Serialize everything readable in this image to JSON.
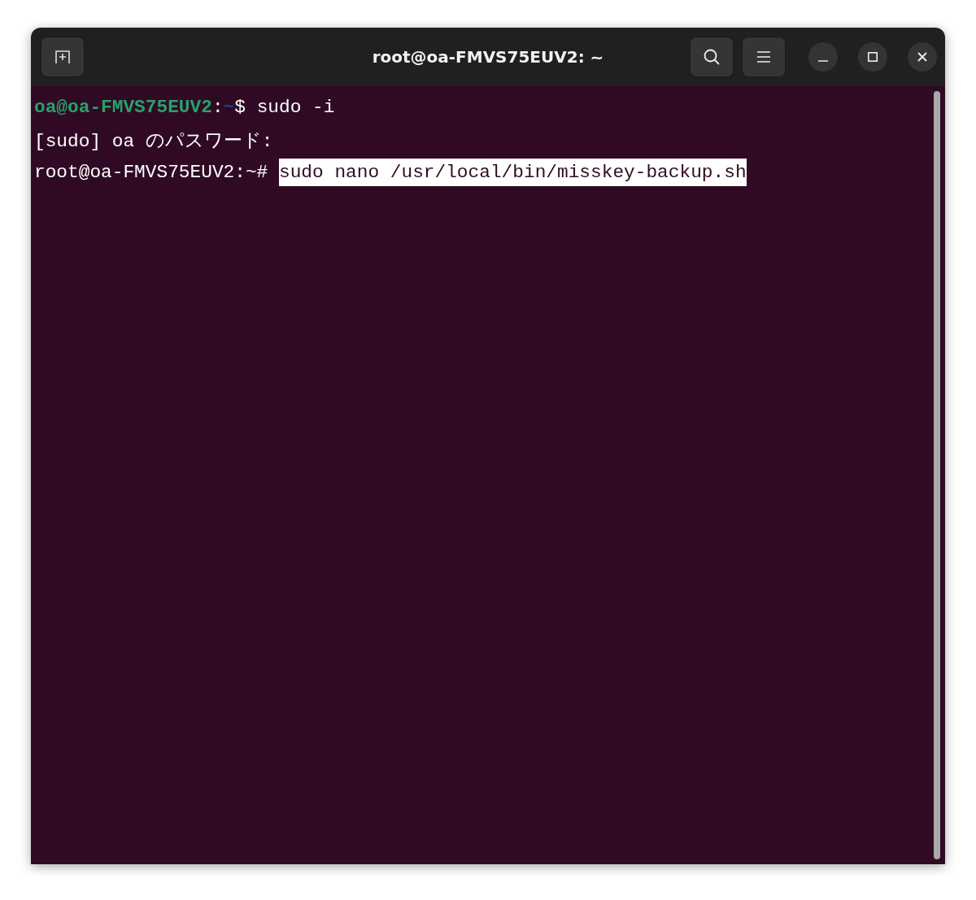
{
  "window": {
    "title": "root@oa-FMVS75EUV2: ~"
  },
  "terminal": {
    "lines": [
      {
        "prompt": [
          {
            "text": "oa@oa-FMVS75EUV2",
            "kind": "user"
          },
          {
            "text": ":",
            "kind": "plain"
          },
          {
            "text": "~",
            "kind": "path"
          },
          {
            "text": "$",
            "kind": "plain"
          }
        ],
        "command": "sudo -i",
        "selected": false
      },
      {
        "output": "[sudo] oa のパスワード:"
      },
      {
        "prompt": [
          {
            "text": "root@oa-FMVS75EUV2:~#",
            "kind": "plain"
          }
        ],
        "command": "sudo nano /usr/local/bin/misskey-backup.sh",
        "selected": true
      }
    ]
  }
}
